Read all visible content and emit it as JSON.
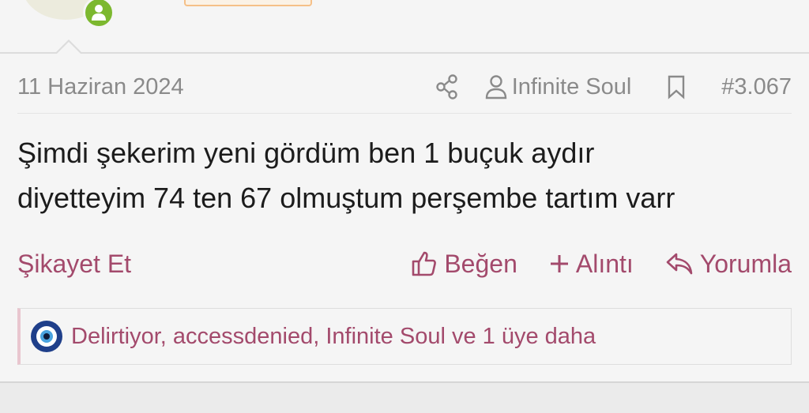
{
  "post": {
    "date": "11 Haziran 2024",
    "author": "Infinite Soul",
    "post_number": "#3.067",
    "body_lines": [
      "Şimdi şekerim yeni gördüm ben 1 buçuk aydır",
      "diyetteyim 74 ten 67 olmuştum perşembe tartım varr"
    ]
  },
  "actions": {
    "report": "Şikayet Et",
    "like": "Beğen",
    "quote": "Alıntı",
    "reply": "Yorumla"
  },
  "reactions": {
    "text": "Delirtiyor, accessdenied, Infinite Soul ve 1 üye daha"
  },
  "icons": {
    "share": "share-icon",
    "user": "user-icon",
    "bookmark": "bookmark-icon",
    "like": "thumbs-up-icon",
    "quote": "plus-icon",
    "reply": "reply-icon",
    "reaction": "evil-eye-icon",
    "online": "online-user-icon"
  },
  "colors": {
    "accent": "#a34a6c",
    "meta_text": "#8a8a8a",
    "online_badge": "#7cb82f",
    "body_text": "#1c1c1c"
  }
}
